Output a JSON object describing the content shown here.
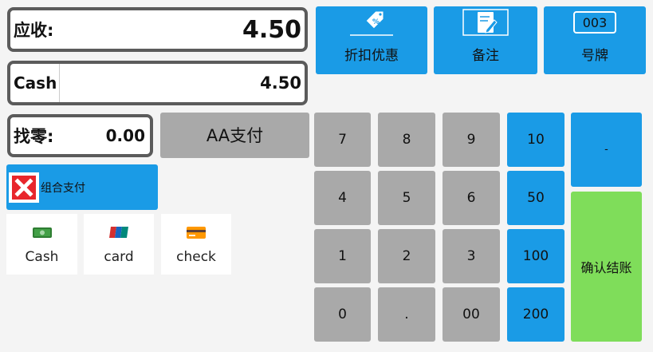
{
  "receivable": {
    "label": "应收:",
    "value": "4.50"
  },
  "cash": {
    "label": "Cash",
    "value": "4.50"
  },
  "change": {
    "label": "找零:",
    "value": "0.00"
  },
  "aa_pay": "AA支付",
  "combo_pay": "组合支付",
  "top_buttons": {
    "discount": "折扣优惠",
    "note": "备注",
    "plate": "号牌",
    "plate_icon_text": "003"
  },
  "payment_methods": [
    "Cash",
    "card",
    "check"
  ],
  "keypad": {
    "rows": [
      [
        "7",
        "8",
        "9",
        "10"
      ],
      [
        "4",
        "5",
        "6",
        "50"
      ],
      [
        "1",
        "2",
        "3",
        "100"
      ],
      [
        "0",
        ".",
        "00",
        "200"
      ]
    ],
    "minus": "-",
    "confirm": "确认结账"
  },
  "colors": {
    "blue": "#1a9be6",
    "gray": "#a9a9a9",
    "green": "#7fdd5a",
    "close_red": "#e8262c"
  }
}
